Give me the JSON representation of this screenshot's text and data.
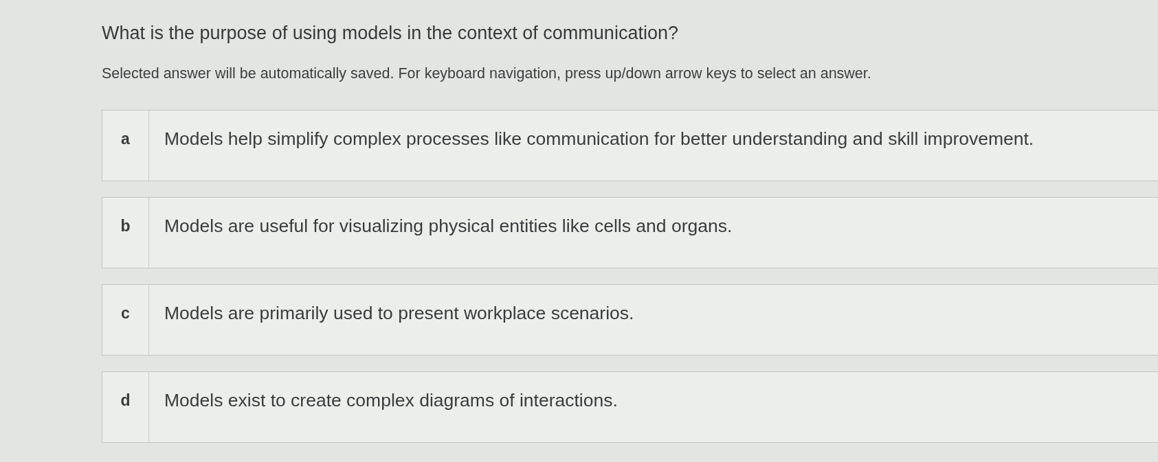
{
  "question": {
    "title": "What is the purpose of using models in the context of communication?",
    "instructions": "Selected answer will be automatically saved. For keyboard navigation, press up/down arrow keys to select an answer."
  },
  "options": [
    {
      "letter": "a",
      "text": "Models help simplify complex processes like communication for better understanding and skill improvement.",
      "selected": false
    },
    {
      "letter": "b",
      "text": "Models are useful for visualizing physical entities like cells and organs.",
      "selected": false
    },
    {
      "letter": "c",
      "text": "Models are primarily used to present workplace scenarios.",
      "selected": false
    },
    {
      "letter": "d",
      "text": "Models exist to create complex diagrams of interactions.",
      "selected": false
    }
  ]
}
